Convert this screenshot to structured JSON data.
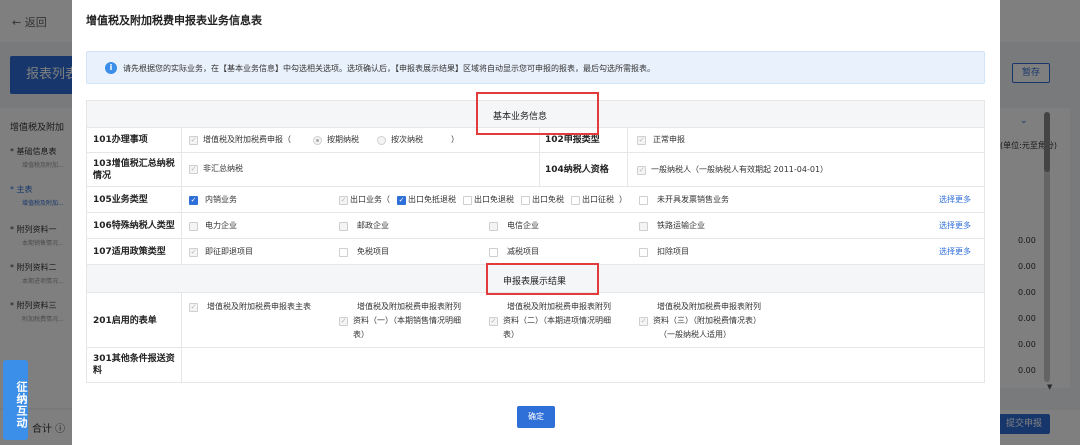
{
  "background": {
    "back_label": "← 返回",
    "list_button": "报表列表",
    "save_button": "暂存",
    "submit_button": "提交申报",
    "total_label": "合计 ⓘ",
    "unit_label": "(单位:元至角分)",
    "nav": {
      "head": "增值税及附加",
      "items": [
        {
          "label": "* 基础信息表",
          "sub": "增值税及附加..."
        },
        {
          "label": "* 主表",
          "sub": "增值税及附加..."
        },
        {
          "label": "* 附列资料一",
          "sub": "本期销售情况..."
        },
        {
          "label": "* 附列资料二",
          "sub": "本期进项情况..."
        },
        {
          "label": "* 附列资料三",
          "sub": "附加税费情况..."
        }
      ]
    },
    "zeros": [
      "0.00",
      "0.00",
      "0.00",
      "0.00",
      "0.00",
      "0.00"
    ]
  },
  "side_widget": "征纳互动",
  "modal": {
    "title": "增值税及附加税费申报表业务信息表",
    "info": "请先根据您的实际业务，在【基本业务信息】中勾选相关选项。选项确认后，【申报表展示结果】区域将自动显示您可申报的报表，最后勾选所需报表。",
    "info_icon": "i",
    "section_basic": "基本业务信息",
    "section_result": "申报表展示结果",
    "confirm": "确定",
    "more_link": "选择更多",
    "r101": {
      "label": "101办理事项",
      "item": "增值税及附加税费申报（",
      "radio1": "按期纳税",
      "radio2": "按次纳税",
      "close": "）"
    },
    "r102": {
      "label": "102申报类型",
      "value": "正常申报"
    },
    "r103": {
      "label_line1": "103增值税汇总纳税",
      "label_line2": "情况",
      "value": "非汇总纳税"
    },
    "r104": {
      "label": "104纳税人资格",
      "value": "一般纳税人（一般纳税人有效期起 2011-04-01）"
    },
    "r105": {
      "label": "105业务类型",
      "domestic": "内销业务",
      "export": "出口业务（",
      "opt1": "出口免抵退税",
      "opt2": "出口免退税",
      "opt3": "出口免税",
      "opt4": "出口征税",
      "close": "）",
      "no_invoice": "未开具发票销售业务"
    },
    "r106": {
      "label": "106特殊纳税人类型",
      "opt1": "电力企业",
      "opt2": "邮政企业",
      "opt3": "电信企业",
      "opt4": "铁路运输企业"
    },
    "r107": {
      "label": "107适用政策类型",
      "opt1": "即征即退项目",
      "opt2": "免税项目",
      "opt3": "减税项目",
      "opt4": "扣除项目"
    },
    "r201": {
      "label": "201启用的表单",
      "f1": "增值税及附加税费申报表主表",
      "f2": [
        "增值税及附加税费申报表附列",
        "资料（一）（本期销售情况明细",
        "表）"
      ],
      "f3": [
        "增值税及附加税费申报表附列",
        "资料（二）（本期进项情况明细",
        "表）"
      ],
      "f4": [
        "增值税及附加税费申报表附列",
        "资料（三）（附加税费情况表）",
        "（一般纳税人适用）"
      ]
    },
    "r301": {
      "label_line1": "301其他条件报送资",
      "label_line2": "料"
    }
  }
}
